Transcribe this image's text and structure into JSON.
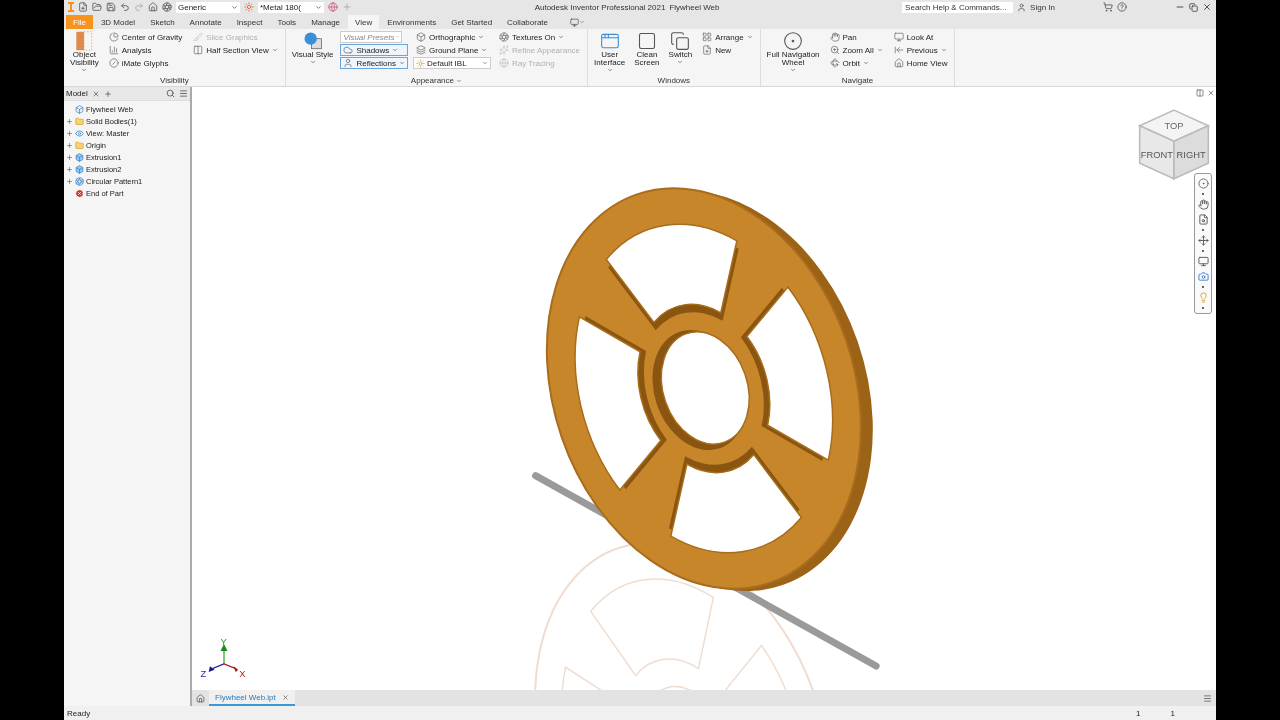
{
  "quick_access": {
    "material": "Generic",
    "appearance": "*Metal 180("
  },
  "window": {
    "title": "Autodesk Inventor Professional 2021",
    "document": "Flywheel Web"
  },
  "help": {
    "search_placeholder": "Search Help & Commands...",
    "sign_in": "Sign In"
  },
  "tabs": [
    {
      "label": "File",
      "selected": false,
      "kind": "file"
    },
    {
      "label": "3D Model",
      "selected": false
    },
    {
      "label": "Sketch",
      "selected": false
    },
    {
      "label": "Annotate",
      "selected": false
    },
    {
      "label": "Inspect",
      "selected": false
    },
    {
      "label": "Tools",
      "selected": false
    },
    {
      "label": "Manage",
      "selected": false
    },
    {
      "label": "View",
      "selected": true
    },
    {
      "label": "Environments",
      "selected": false
    },
    {
      "label": "Get Started",
      "selected": false
    },
    {
      "label": "Collaborate",
      "selected": false
    }
  ],
  "ribbon": [
    {
      "title": "Visibility",
      "menu": false,
      "columns": [
        [
          {
            "kind": "large",
            "label": "Object\nVisibility",
            "dropdown": true,
            "disabled": false
          }
        ],
        [
          {
            "kind": "small",
            "label": "Center of Gravity",
            "dropdown": false,
            "disabled": false,
            "toggled": false
          },
          {
            "kind": "small",
            "label": "Analysis",
            "dropdown": false,
            "disabled": false,
            "toggled": false
          },
          {
            "kind": "small",
            "label": "iMate Glyphs",
            "dropdown": false,
            "disabled": false,
            "toggled": false
          }
        ],
        [
          {
            "kind": "small",
            "label": "Slice Graphics",
            "dropdown": false,
            "disabled": true,
            "toggled": false
          },
          {
            "kind": "small",
            "label": "Half Section View",
            "dropdown": true,
            "disabled": false,
            "toggled": false
          }
        ]
      ]
    },
    {
      "title": "Appearance",
      "menu": true,
      "columns": [
        [
          {
            "kind": "large",
            "label": "Visual Style",
            "dropdown": true,
            "disabled": false
          }
        ],
        [
          {
            "kind": "combo",
            "placeholder": "Visual Presets"
          },
          {
            "kind": "small",
            "label": "Shadows",
            "dropdown": true,
            "disabled": false,
            "toggled": true
          },
          {
            "kind": "small",
            "label": "Reflections",
            "dropdown": true,
            "disabled": false,
            "toggled": true
          }
        ],
        [
          {
            "kind": "small",
            "label": "Orthographic",
            "dropdown": true,
            "disabled": false,
            "toggled": false
          },
          {
            "kind": "small",
            "label": "Ground Plane",
            "dropdown": true,
            "disabled": false,
            "toggled": false
          },
          {
            "kind": "combo",
            "value": "Default IBL"
          }
        ],
        [
          {
            "kind": "small",
            "label": "Textures On",
            "dropdown": true,
            "disabled": false,
            "toggled": false
          },
          {
            "kind": "small",
            "label": "Refine Appearance",
            "dropdown": false,
            "disabled": true,
            "toggled": false
          },
          {
            "kind": "small",
            "label": "Ray Tracing",
            "dropdown": false,
            "disabled": true,
            "toggled": false
          }
        ]
      ]
    },
    {
      "title": "Windows",
      "menu": false,
      "columns": [
        [
          {
            "kind": "large",
            "label": "User\nInterface",
            "dropdown": true,
            "disabled": false
          }
        ],
        [
          {
            "kind": "large",
            "label": "Clean\nScreen",
            "dropdown": false,
            "disabled": false
          }
        ],
        [
          {
            "kind": "large",
            "label": "Switch",
            "dropdown": true,
            "disabled": false
          }
        ],
        [
          {
            "kind": "small",
            "label": "Arrange",
            "dropdown": true,
            "disabled": false,
            "toggled": false
          },
          {
            "kind": "small",
            "label": "New",
            "dropdown": false,
            "disabled": false,
            "toggled": false
          }
        ]
      ]
    },
    {
      "title": "Navigate",
      "menu": false,
      "columns": [
        [
          {
            "kind": "large",
            "label": "Full Navigation\nWheel",
            "dropdown": true,
            "disabled": false
          }
        ],
        [
          {
            "kind": "small",
            "label": "Pan",
            "dropdown": false,
            "disabled": false,
            "toggled": false
          },
          {
            "kind": "small",
            "label": "Zoom All",
            "dropdown": true,
            "disabled": false,
            "toggled": false
          },
          {
            "kind": "small",
            "label": "Orbit",
            "dropdown": true,
            "disabled": false,
            "toggled": false
          }
        ],
        [
          {
            "kind": "small",
            "label": "Look At",
            "dropdown": false,
            "disabled": false,
            "toggled": false
          },
          {
            "kind": "small",
            "label": "Previous",
            "dropdown": true,
            "disabled": false,
            "toggled": false
          },
          {
            "kind": "small",
            "label": "Home View",
            "dropdown": false,
            "disabled": false,
            "toggled": false
          }
        ]
      ]
    }
  ],
  "browser": {
    "tab": "Model",
    "tree": [
      {
        "label": "Flywheel Web",
        "kind": "part",
        "children": [
          {
            "label": "Solid Bodies(1)",
            "kind": "bodies",
            "expanded": false
          },
          {
            "label": "View: Master",
            "kind": "view",
            "expanded": false
          },
          {
            "label": "Origin",
            "kind": "folder",
            "expanded": false
          },
          {
            "label": "Extrusion1",
            "kind": "extrusion",
            "expanded": false
          },
          {
            "label": "Extrusion2",
            "kind": "extrusion",
            "expanded": false
          },
          {
            "label": "Circular Pattern1",
            "kind": "pattern",
            "expanded": false
          },
          {
            "label": "End of Part",
            "kind": "end"
          }
        ]
      }
    ]
  },
  "viewcube": {
    "faces": [
      "TOP",
      "FRONT",
      "RIGHT"
    ]
  },
  "triad": {
    "y": "Y",
    "z": "Z",
    "x": "X"
  },
  "document_tabs": [
    {
      "label": "Flywheel Web.ipt",
      "selected": true
    }
  ],
  "status_bar": {
    "message": "Ready",
    "counts": [
      "1",
      "1"
    ]
  }
}
